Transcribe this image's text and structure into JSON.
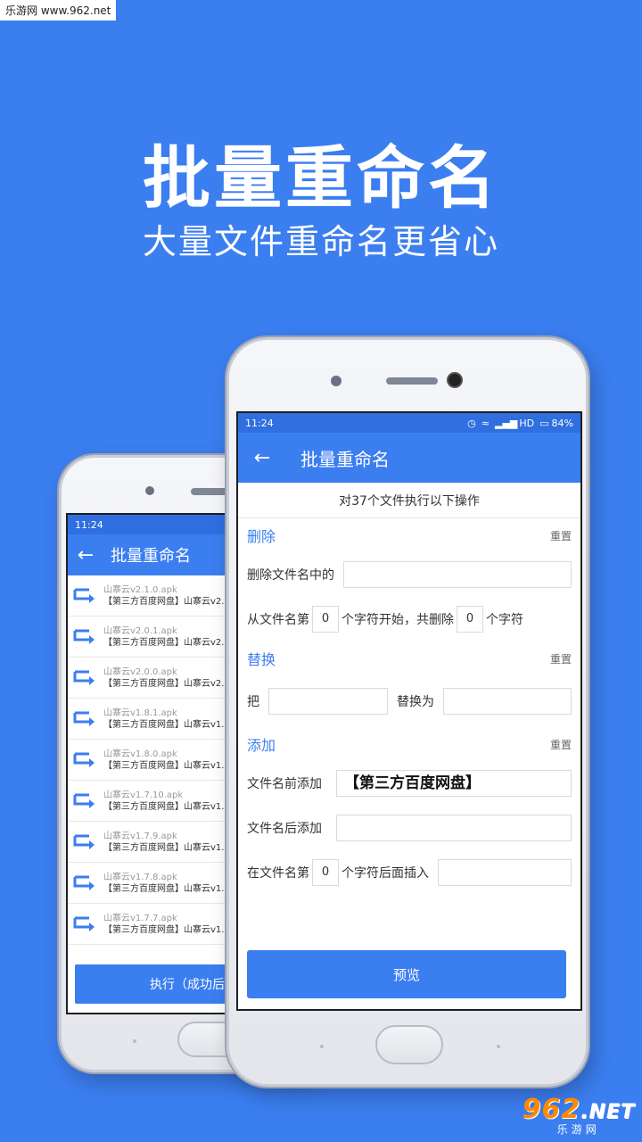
{
  "watermark_top": "乐游网 www.962.net",
  "hero": {
    "title": "批量重命名",
    "subtitle": "大量文件重命名更省心"
  },
  "back_phone": {
    "status_time": "11:24",
    "toolbar_title": "批量重命名",
    "files": [
      {
        "old": "山寨云v2.1.0.apk",
        "new": "【第三方百度网盘】山寨云v2.1"
      },
      {
        "old": "山寨云v2.0.1.apk",
        "new": "【第三方百度网盘】山寨云v2.0"
      },
      {
        "old": "山寨云v2.0.0.apk",
        "new": "【第三方百度网盘】山寨云v2.0"
      },
      {
        "old": "山寨云v1.8.1.apk",
        "new": "【第三方百度网盘】山寨云v1.8"
      },
      {
        "old": "山寨云v1.8.0.apk",
        "new": "【第三方百度网盘】山寨云v1.8"
      },
      {
        "old": "山寨云v1.7.10.apk",
        "new": "【第三方百度网盘】山寨云v1.7"
      },
      {
        "old": "山寨云v1.7.9.apk",
        "new": "【第三方百度网盘】山寨云v1.7"
      },
      {
        "old": "山寨云v1.7.8.apk",
        "new": "【第三方百度网盘】山寨云v1.7"
      },
      {
        "old": "山寨云v1.7.7.apk",
        "new": "【第三方百度网盘】山寨云v1.7"
      }
    ],
    "exec_button": "执行（成功后不可"
  },
  "front_phone": {
    "status_time": "11:24",
    "status_network": "HD",
    "status_battery": "84%",
    "toolbar_title": "批量重命名",
    "operation_header": "对37个文件执行以下操作",
    "delete_section": {
      "title": "删除",
      "reset": "重置",
      "row1_label": "删除文件名中的",
      "row2_prefix": "从文件名第",
      "row2_start": "0",
      "row2_middle": "个字符开始，共删除",
      "row2_count": "0",
      "row2_suffix": "个字符"
    },
    "replace_section": {
      "title": "替换",
      "reset": "重置",
      "label_from": "把",
      "label_to": "替换为"
    },
    "add_section": {
      "title": "添加",
      "reset": "重置",
      "prefix_label": "文件名前添加",
      "prefix_value": "【第三方百度网盘】",
      "suffix_label": "文件名后添加",
      "insert_prefix": "在文件名第",
      "insert_pos": "0",
      "insert_suffix": "个字符后面插入"
    },
    "preview_button": "预览"
  },
  "watermark_br": {
    "logo": "962",
    "logo_net": ".NET",
    "sub": "乐游网"
  },
  "colors": {
    "background": "#3b7ef0",
    "accent": "#3b7ef0",
    "status_bar": "#2f6fe0"
  }
}
